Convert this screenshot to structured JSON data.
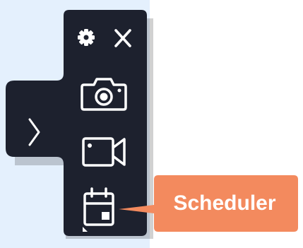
{
  "toolbar": {
    "icons": {
      "settings": "gear-icon",
      "close": "close-icon",
      "screenshot": "camera-icon",
      "record": "video-camera-icon",
      "scheduler": "calendar-icon",
      "expand": "chevron-right-icon"
    },
    "tooltip": "Scheduler"
  },
  "colors": {
    "desktop_background": "#e4f0fd",
    "panel": "#1d212e",
    "icon": "#ffffff",
    "tooltip": "#f38a5e"
  }
}
